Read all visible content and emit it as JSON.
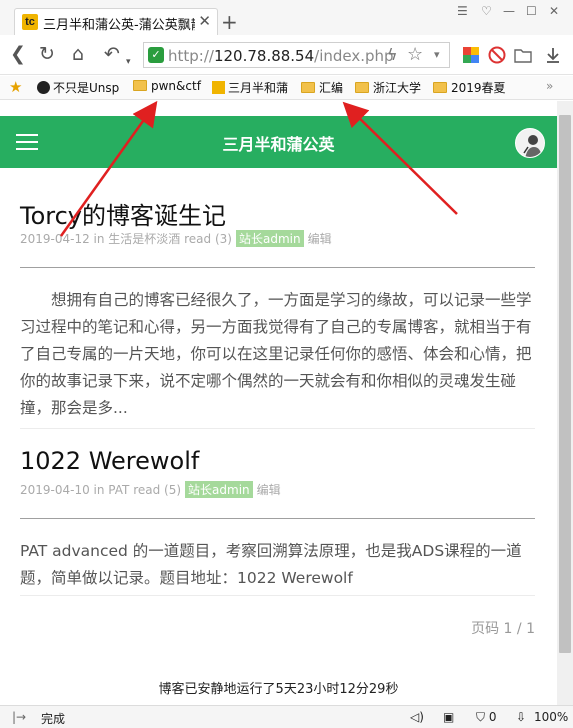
{
  "browser": {
    "tab_title": "三月半和蒲公英-蒲公英飘散",
    "tab_favicon": "tc",
    "new_tab": "+",
    "url_prefix": "http://",
    "url_host": "120.78.88.54",
    "url_path": "/index.php"
  },
  "bookmarks": [
    {
      "label": "不只是Unsp",
      "icon": "clock-icon"
    },
    {
      "label": "pwn&ctf",
      "icon": "folder-icon"
    },
    {
      "label": "三月半和蒲",
      "icon": "site-favicon"
    },
    {
      "label": "汇编",
      "icon": "folder-icon"
    },
    {
      "label": "浙江大学",
      "icon": "folder-icon"
    },
    {
      "label": "2019春夏",
      "icon": "folder-icon"
    }
  ],
  "site": {
    "title": "三月半和蒲公英",
    "accent_color": "#27ae60"
  },
  "posts": [
    {
      "title": "Torcy的博客诞生记",
      "meta_text": "2019-04-12 in 生活是杯淡酒 read (3)",
      "author": "站长admin",
      "edit": "编辑",
      "excerpt": "想拥有自己的博客已经很久了，一方面是学习的缘故，可以记录一些学习过程中的笔记和心得，另一方面我觉得有了自己的专属博客，就相当于有了自己专属的一片天地，你可以在这里记录任何你的感悟、体会和心情，把你的故事记录下来，说不定哪个偶然的一天就会有和你相似的灵魂发生碰撞，那会是多..."
    },
    {
      "title": "1022 Werewolf",
      "meta_text": "2019-04-10 in PAT read (5)",
      "author": "站长admin",
      "edit": "编辑",
      "excerpt": "PAT advanced 的一道题目，考察回溯算法原理，也是我ADS课程的一道题，简单做以记录。题目地址：1022 Werewolf"
    }
  ],
  "pager": "页码 1 / 1",
  "uptime": "博客已安静地运行了5天23小时12分29秒",
  "status": {
    "text": "完成",
    "badge": "0",
    "zoom": "100%"
  },
  "annotation_color": "#e02020"
}
